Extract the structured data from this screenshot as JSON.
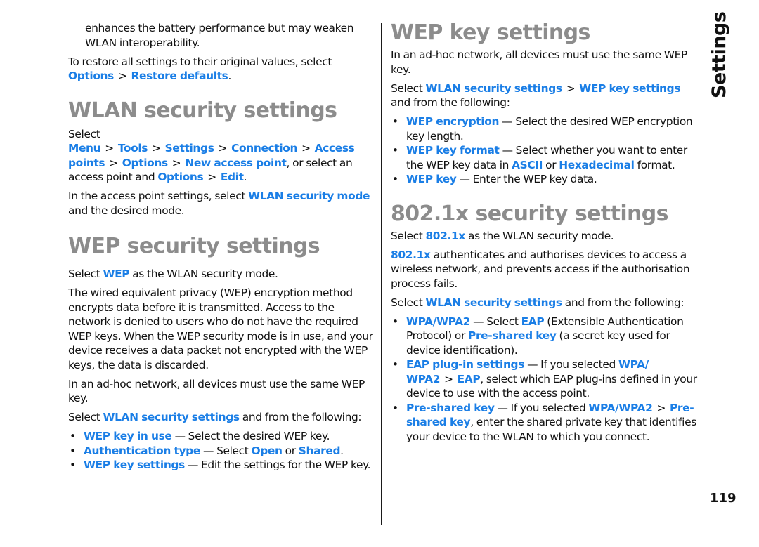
{
  "side_tab": "Settings",
  "page_number": "119",
  "colors": {
    "link": "#1a7ee6",
    "heading": "#8c8c8c",
    "text": "#111111"
  },
  "left": {
    "intro": {
      "p1": "enhances the battery performance but may weaken WLAN interoperability.",
      "p2_text": "To restore all settings to their original values, select",
      "p2_links": [
        "Options",
        "Restore defaults"
      ],
      "p2_end": "."
    },
    "wlan_security": {
      "title": "WLAN security settings",
      "p1": {
        "select": "Select",
        "path1": [
          "Menu",
          "Tools",
          "Settings",
          "Connection",
          "Access points",
          "Options",
          "New access point"
        ],
        "mid": ", or select an access point and",
        "path2": [
          "Options",
          "Edit"
        ],
        "end": "."
      },
      "p2": {
        "pre": "In the access point settings, select",
        "link": "WLAN security mode",
        "post": "and the desired mode."
      }
    },
    "wep_security": {
      "title": "WEP security settings",
      "p1": {
        "pre": "Select",
        "link": "WEP",
        "post": "as the WLAN security mode."
      },
      "p2": "The wired equivalent privacy (WEP) encryption method encrypts data before it is transmitted. Access to the network is denied to users who do not have the required WEP keys. When the WEP security mode is in use, and your device receives a data packet not encrypted with the WEP keys, the data is discarded.",
      "p3": "In an ad-hoc network, all devices must use the same WEP key.",
      "p4": {
        "pre": "Select",
        "link": "WLAN security settings",
        "post": "and from the following:"
      },
      "bullets": [
        {
          "term": "WEP key in use",
          "desc": " — Select the desired WEP key."
        },
        {
          "term": "Authentication type",
          "desc": " — Select ",
          "opt1": "Open",
          "or": " or ",
          "opt2": "Shared",
          "end": "."
        },
        {
          "term": "WEP key settings",
          "desc": " — Edit the settings for the WEP key."
        }
      ]
    }
  },
  "right": {
    "wep_key": {
      "title": "WEP key settings",
      "p1": "In an ad-hoc network, all devices must use the same WEP key.",
      "p2": {
        "pre": "Select",
        "path": [
          "WLAN security settings",
          "WEP key settings"
        ],
        "post": "and from the following:"
      },
      "bullets": [
        {
          "term": "WEP encryption",
          "desc": " — Select the desired WEP encryption key length."
        },
        {
          "term": "WEP key format",
          "desc": " — Select whether you want to enter the WEP key data in ",
          "opt1": "ASCII",
          "or": " or ",
          "opt2": "Hexadecimal",
          "end": " format."
        },
        {
          "term": "WEP key",
          "desc": " — Enter the WEP key data."
        }
      ]
    },
    "x8021": {
      "title": "802.1x security settings",
      "p1": {
        "pre": "Select",
        "link": "802.1x",
        "post": "as the WLAN security mode."
      },
      "p2": {
        "link": "802.1x",
        "post": "authenticates and authorises devices to access a wireless network, and prevents access if the authorisation process fails."
      },
      "p3": {
        "pre": "Select",
        "link": "WLAN security settings",
        "post": "and from the following:"
      },
      "bullets": [
        {
          "term": "WPA/WPA2",
          "t1": " — Select ",
          "l1": "EAP",
          "t2": " (Extensible Authentication Protocol) or ",
          "l2": "Pre-shared key",
          "t3": " (a secret key used for device identification)."
        },
        {
          "term": "EAP plug-in settings",
          "t1": " — If you selected ",
          "l1": "WPA/ WPA2",
          "sep": ">",
          "l2": "EAP",
          "t2": ", select which EAP plug-ins defined in your device to use with the access point."
        },
        {
          "term": "Pre-shared key",
          "t1": " — If you selected ",
          "l1": "WPA/WPA2",
          "sep": ">",
          "l2": "Pre-shared key",
          "t2": ", enter the shared private key that identifies your device to the WLAN to which you connect."
        }
      ]
    }
  },
  "bullet_glyph": "•",
  "path_separator": ">"
}
